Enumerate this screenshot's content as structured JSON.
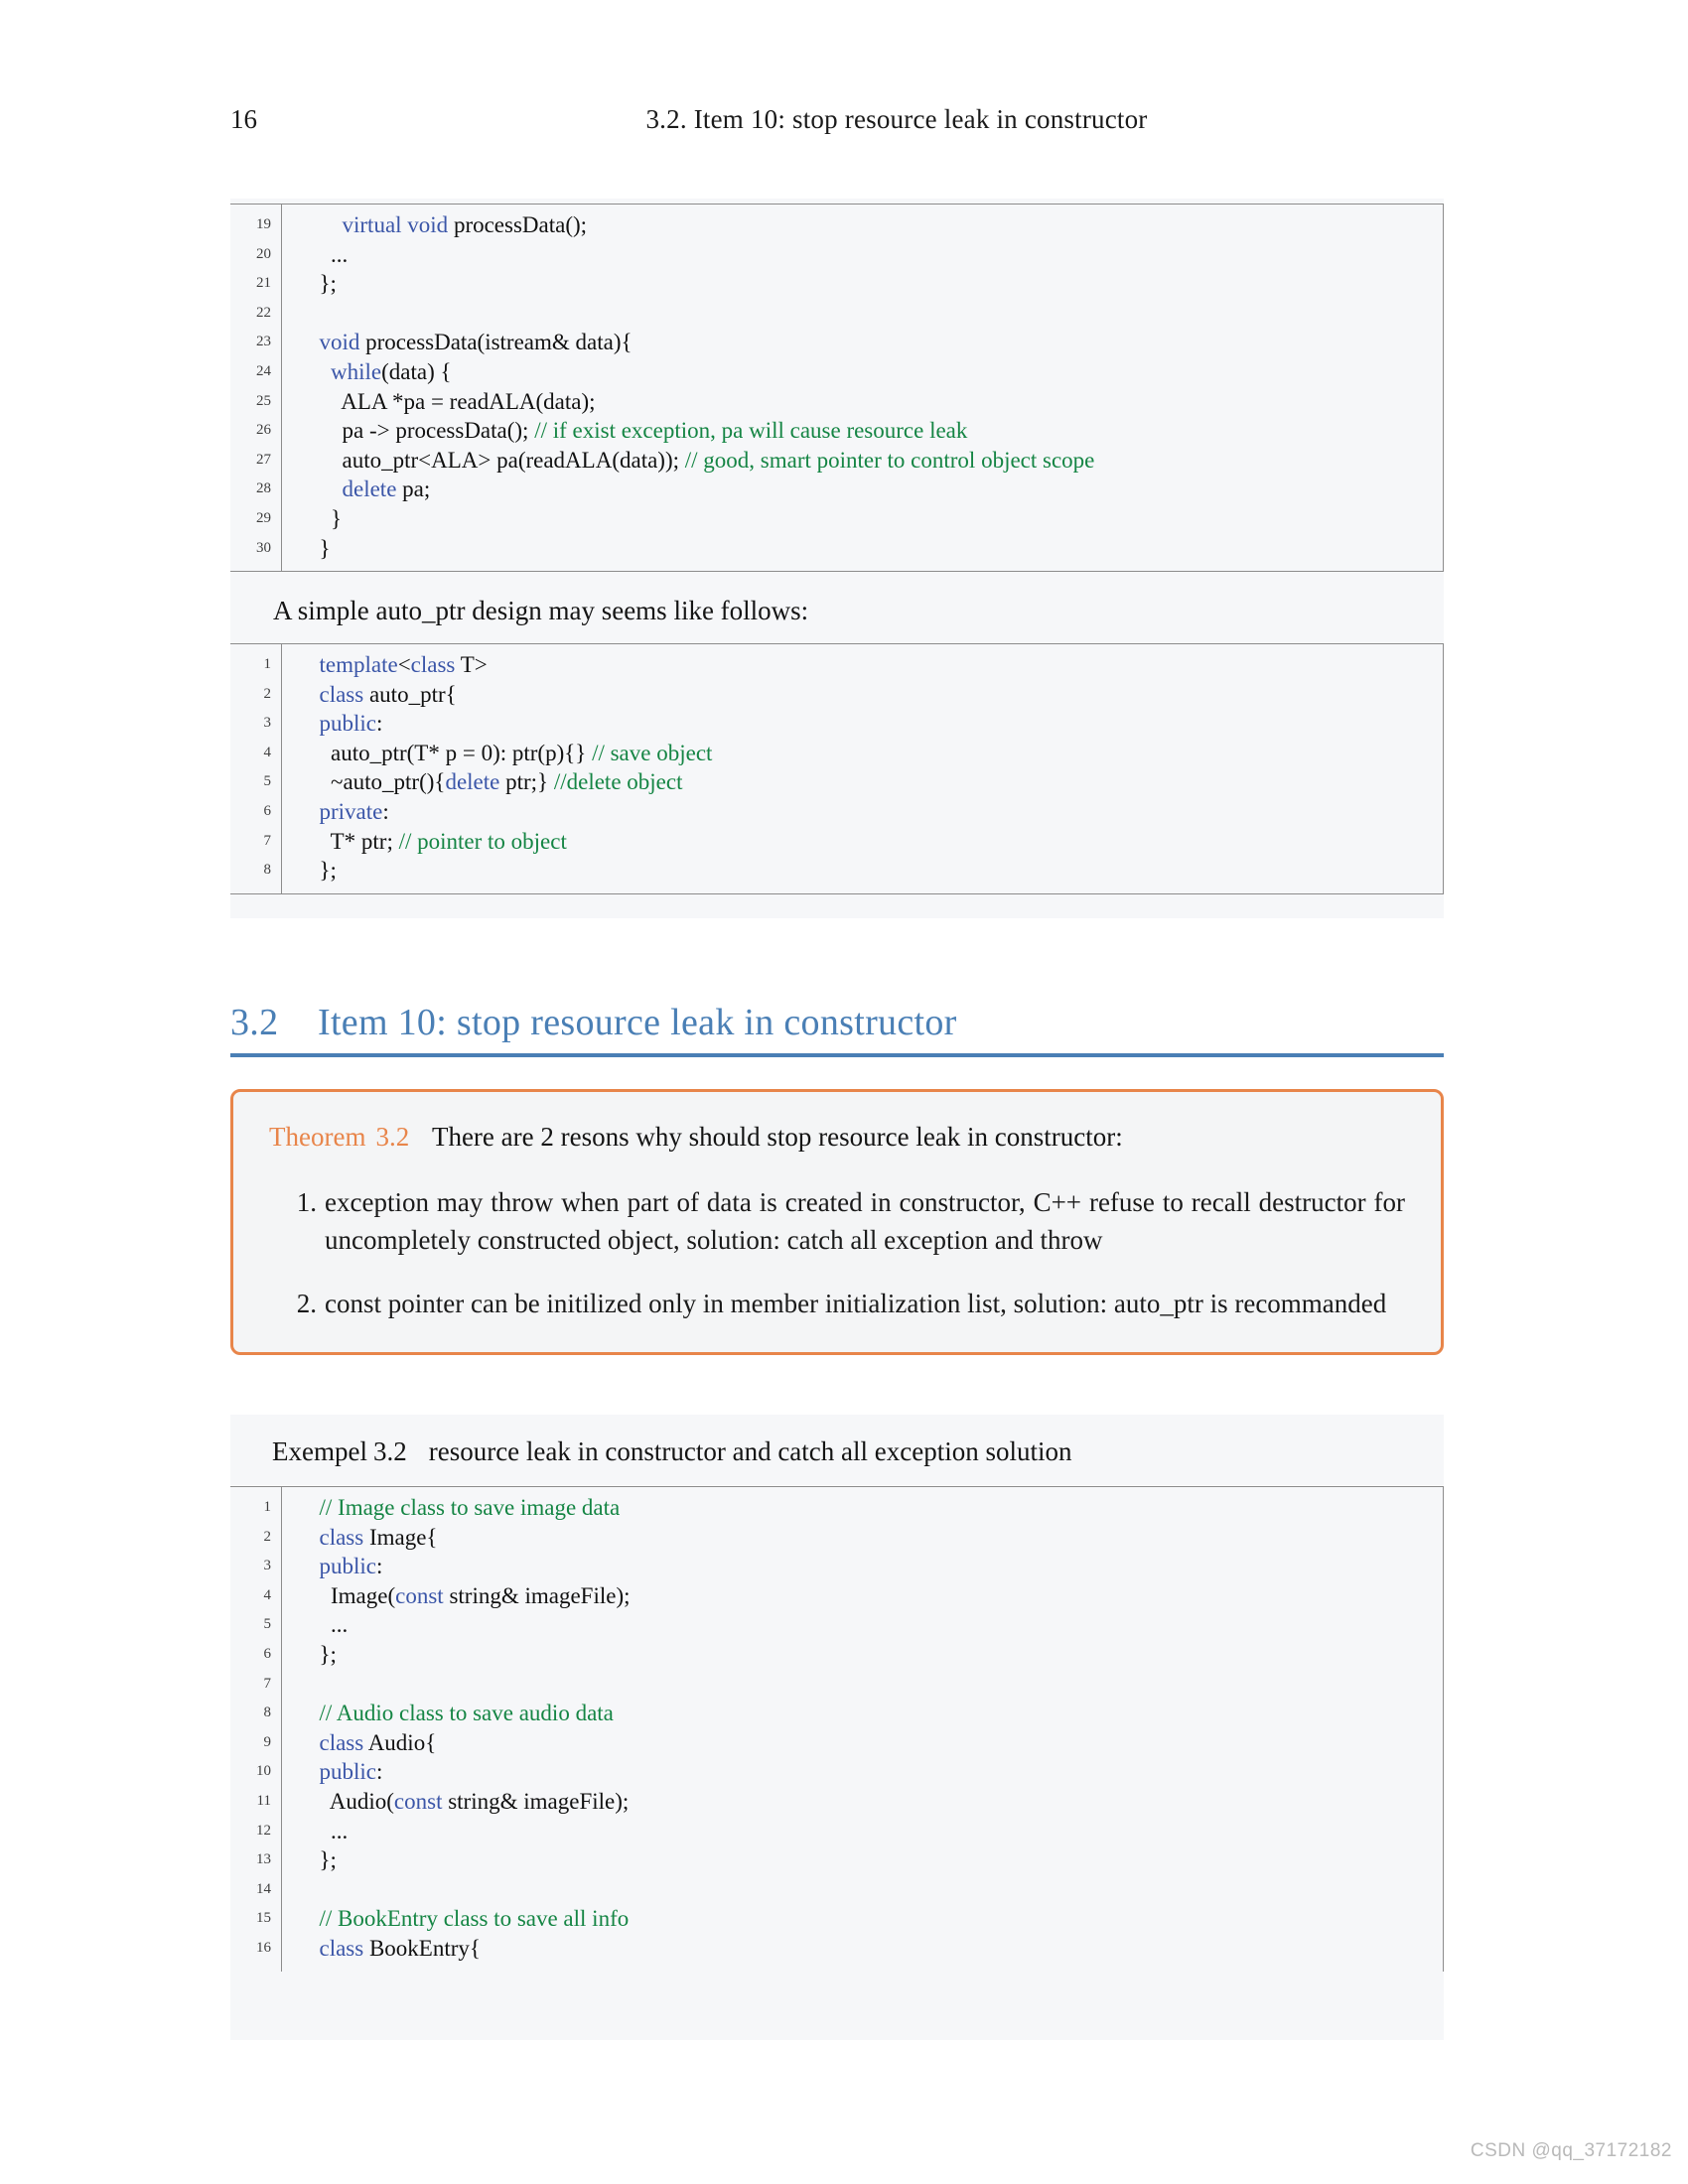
{
  "header": {
    "folio": "16",
    "title": "3.2.  Item 10: stop resource leak in constructor"
  },
  "listing1": {
    "line_numbers": [
      "19",
      "20",
      "21",
      "22",
      "23",
      "24",
      "25",
      "26",
      "27",
      "28",
      "29",
      "30"
    ],
    "lines": [
      {
        "indent": "      ",
        "parts": [
          {
            "t": "virtual void",
            "c": "kw"
          },
          {
            "t": " processData();",
            "c": "plain"
          }
        ]
      },
      {
        "indent": "    ",
        "parts": [
          {
            "t": "...",
            "c": "plain"
          }
        ]
      },
      {
        "indent": "  ",
        "parts": [
          {
            "t": "};",
            "c": "plain"
          }
        ]
      },
      {
        "indent": "",
        "parts": []
      },
      {
        "indent": "  ",
        "parts": [
          {
            "t": "void",
            "c": "kw"
          },
          {
            "t": " processData(istream& data){",
            "c": "plain"
          }
        ]
      },
      {
        "indent": "    ",
        "parts": [
          {
            "t": "while",
            "c": "kw"
          },
          {
            "t": "(data) {",
            "c": "plain"
          }
        ]
      },
      {
        "indent": "      ",
        "parts": [
          {
            "t": "ALA *pa = readALA(data);",
            "c": "plain"
          }
        ]
      },
      {
        "indent": "      ",
        "parts": [
          {
            "t": "pa -> processData(); ",
            "c": "plain"
          },
          {
            "t": "// if exist exception, pa will cause resource leak",
            "c": "cm"
          }
        ]
      },
      {
        "indent": "      ",
        "parts": [
          {
            "t": "auto_ptr<ALA> pa(readALA(data)); ",
            "c": "plain"
          },
          {
            "t": "// good, smart pointer to control object scope",
            "c": "cm"
          }
        ]
      },
      {
        "indent": "      ",
        "parts": [
          {
            "t": "delete",
            "c": "kw"
          },
          {
            "t": " pa;",
            "c": "plain"
          }
        ]
      },
      {
        "indent": "    ",
        "parts": [
          {
            "t": "}",
            "c": "plain"
          }
        ]
      },
      {
        "indent": "  ",
        "parts": [
          {
            "t": "}",
            "c": "plain"
          }
        ]
      }
    ]
  },
  "between_text": "A simple auto_ptr design may seems like follows:",
  "listing2": {
    "line_numbers": [
      "1",
      "2",
      "3",
      "4",
      "5",
      "6",
      "7",
      "8"
    ],
    "lines": [
      {
        "indent": "  ",
        "parts": [
          {
            "t": "template",
            "c": "kw"
          },
          {
            "t": "<",
            "c": "plain"
          },
          {
            "t": "class",
            "c": "kw"
          },
          {
            "t": " T>",
            "c": "plain"
          }
        ]
      },
      {
        "indent": "  ",
        "parts": [
          {
            "t": "class",
            "c": "kw"
          },
          {
            "t": " auto_ptr{",
            "c": "plain"
          }
        ]
      },
      {
        "indent": "  ",
        "parts": [
          {
            "t": "public",
            "c": "kw"
          },
          {
            "t": ":",
            "c": "plain"
          }
        ]
      },
      {
        "indent": "    ",
        "parts": [
          {
            "t": "auto_ptr(T* p = 0): ptr(p){} ",
            "c": "plain"
          },
          {
            "t": "// save object",
            "c": "cm"
          }
        ]
      },
      {
        "indent": "    ",
        "parts": [
          {
            "t": "~auto_ptr(){",
            "c": "plain"
          },
          {
            "t": "delete",
            "c": "kw"
          },
          {
            "t": " ptr;} ",
            "c": "plain"
          },
          {
            "t": "//delete object",
            "c": "cm"
          }
        ]
      },
      {
        "indent": "  ",
        "parts": [
          {
            "t": "private",
            "c": "kw"
          },
          {
            "t": ":",
            "c": "plain"
          }
        ]
      },
      {
        "indent": "    ",
        "parts": [
          {
            "t": "T* ptr; ",
            "c": "plain"
          },
          {
            "t": "// pointer to object",
            "c": "cm"
          }
        ]
      },
      {
        "indent": "  ",
        "parts": [
          {
            "t": "};",
            "c": "plain"
          }
        ]
      }
    ]
  },
  "section": {
    "number": "3.2",
    "title": "Item 10: stop resource leak in constructor"
  },
  "theorem": {
    "label": "Theorem",
    "number": "3.2",
    "lead": "There are 2 resons why should stop resource leak in constructor:",
    "items": [
      "exception may throw when part of data is created in constructor, C++ refuse to recall destructor for uncompletely constructed object, solution: catch all exception and throw",
      "const pointer can be initilized only in member initialization list, solution: auto_ptr is recommanded"
    ]
  },
  "exempel": {
    "label": "Exempel",
    "number": "3.2",
    "title": "resource leak in constructor and catch all exception solution"
  },
  "listing3": {
    "line_numbers": [
      "1",
      "2",
      "3",
      "4",
      "5",
      "6",
      "7",
      "8",
      "9",
      "10",
      "11",
      "12",
      "13",
      "14",
      "15",
      "16"
    ],
    "lines": [
      {
        "indent": "  ",
        "parts": [
          {
            "t": "// Image class to save image data",
            "c": "cm"
          }
        ]
      },
      {
        "indent": "  ",
        "parts": [
          {
            "t": "class",
            "c": "kw"
          },
          {
            "t": " Image{",
            "c": "plain"
          }
        ]
      },
      {
        "indent": "  ",
        "parts": [
          {
            "t": "public",
            "c": "kw"
          },
          {
            "t": ":",
            "c": "plain"
          }
        ]
      },
      {
        "indent": "    ",
        "parts": [
          {
            "t": "Image(",
            "c": "plain"
          },
          {
            "t": "const",
            "c": "kw"
          },
          {
            "t": " string& imageFile);",
            "c": "plain"
          }
        ]
      },
      {
        "indent": "    ",
        "parts": [
          {
            "t": "...",
            "c": "plain"
          }
        ]
      },
      {
        "indent": "  ",
        "parts": [
          {
            "t": "};",
            "c": "plain"
          }
        ]
      },
      {
        "indent": "",
        "parts": []
      },
      {
        "indent": "  ",
        "parts": [
          {
            "t": "// Audio class to save audio data",
            "c": "cm"
          }
        ]
      },
      {
        "indent": "  ",
        "parts": [
          {
            "t": "class",
            "c": "kw"
          },
          {
            "t": " Audio{",
            "c": "plain"
          }
        ]
      },
      {
        "indent": "  ",
        "parts": [
          {
            "t": "public",
            "c": "kw"
          },
          {
            "t": ":",
            "c": "plain"
          }
        ]
      },
      {
        "indent": "    ",
        "parts": [
          {
            "t": "Audio(",
            "c": "plain"
          },
          {
            "t": "const",
            "c": "kw"
          },
          {
            "t": " string& imageFile);",
            "c": "plain"
          }
        ]
      },
      {
        "indent": "    ",
        "parts": [
          {
            "t": "...",
            "c": "plain"
          }
        ]
      },
      {
        "indent": "  ",
        "parts": [
          {
            "t": "};",
            "c": "plain"
          }
        ]
      },
      {
        "indent": "",
        "parts": []
      },
      {
        "indent": "  ",
        "parts": [
          {
            "t": "// BookEntry class to save all info",
            "c": "cm"
          }
        ]
      },
      {
        "indent": "  ",
        "parts": [
          {
            "t": "class",
            "c": "kw"
          },
          {
            "t": " BookEntry{",
            "c": "plain"
          }
        ]
      }
    ]
  },
  "watermark": "CSDN @qq_37172182",
  "colors": {
    "keyword": "#3b56a8",
    "comment": "#158544",
    "heading": "#4a7fb5",
    "theorem_accent": "#e8854a",
    "listing_bg": "#f6f7f9"
  }
}
